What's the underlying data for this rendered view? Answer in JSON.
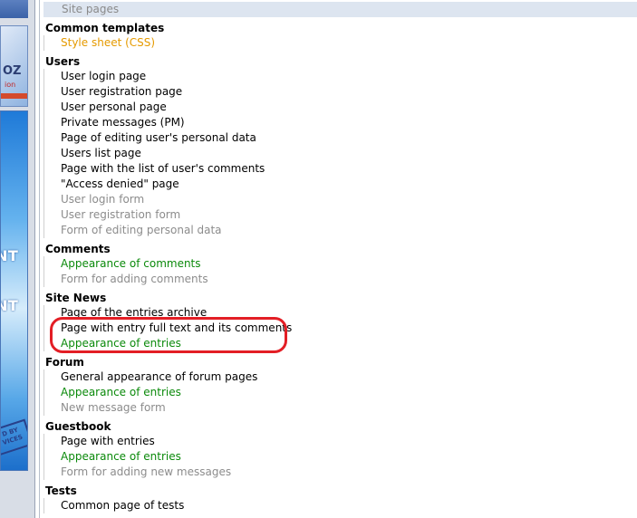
{
  "colors": {
    "normal": "#000000",
    "css_link": "#e59a00",
    "appearance_link": "#0b8a0b",
    "disabled": "#8c8c8c",
    "highlight": "#e31e25"
  },
  "banner": {
    "word_top": "NT",
    "word_bottom": "NT",
    "promo_text": "OZ",
    "promo_sub": "ion",
    "stamp_text": "D BY\nVICES"
  },
  "top_row": {
    "label": "Site pages"
  },
  "sections": [
    {
      "title": "Common templates",
      "items": [
        {
          "label": "Style sheet (CSS)",
          "color": "#e59a00"
        }
      ]
    },
    {
      "title": "Users",
      "items": [
        {
          "label": "User login page",
          "color": "#000000"
        },
        {
          "label": "User registration page",
          "color": "#000000"
        },
        {
          "label": "User personal page",
          "color": "#000000"
        },
        {
          "label": "Private messages (PM)",
          "color": "#000000"
        },
        {
          "label": "Page of editing user's personal data",
          "color": "#000000"
        },
        {
          "label": "Users list page",
          "color": "#000000"
        },
        {
          "label": "Page with the list of user's comments",
          "color": "#000000"
        },
        {
          "label": "\"Access denied\" page",
          "color": "#000000"
        },
        {
          "label": "User login form",
          "color": "#8c8c8c"
        },
        {
          "label": "User registration form",
          "color": "#8c8c8c"
        },
        {
          "label": "Form of editing personal data",
          "color": "#8c8c8c"
        }
      ]
    },
    {
      "title": "Comments",
      "items": [
        {
          "label": "Appearance of comments",
          "color": "#0b8a0b"
        },
        {
          "label": "Form for adding comments",
          "color": "#8c8c8c"
        }
      ]
    },
    {
      "title": "Site News",
      "items": [
        {
          "label": "Page of the entries archive",
          "color": "#000000"
        },
        {
          "label": "Page with entry full text and its comments",
          "color": "#000000"
        },
        {
          "label": "Appearance of entries",
          "color": "#0b8a0b"
        }
      ]
    },
    {
      "title": "Forum",
      "items": [
        {
          "label": "General appearance of forum pages",
          "color": "#000000"
        },
        {
          "label": "Appearance of entries",
          "color": "#0b8a0b"
        },
        {
          "label": "New message form",
          "color": "#8c8c8c"
        }
      ]
    },
    {
      "title": "Guestbook",
      "items": [
        {
          "label": "Page with entries",
          "color": "#000000"
        },
        {
          "label": "Appearance of entries",
          "color": "#0b8a0b"
        },
        {
          "label": "Form for adding new messages",
          "color": "#8c8c8c"
        }
      ]
    },
    {
      "title": "Tests",
      "items": [
        {
          "label": "Common page of tests",
          "color": "#000000"
        }
      ]
    }
  ]
}
